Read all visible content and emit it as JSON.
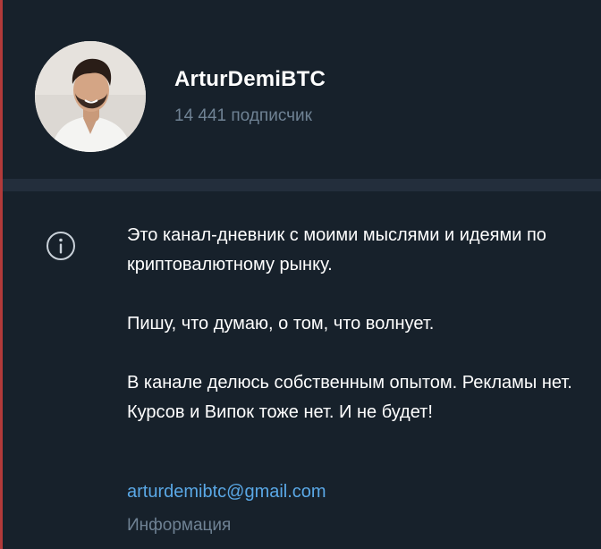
{
  "channel": {
    "name": "ArturDemiBTC",
    "subscribers": "14 441 подписчик"
  },
  "info": {
    "paragraphs": [
      "Это канал-дневник с моими мыслями и идеями по криптовалютному рынку.",
      "Пишу, что думаю, о том, что волнует.",
      "В канале делюсь собственным опытом. Рекламы нет. Курсов и Випок тоже нет. И не будет!"
    ],
    "email": "arturdemibtc@gmail.com",
    "label": "Информация"
  },
  "colors": {
    "background": "#17212b",
    "divider": "#232e3c",
    "link": "#5aa8e6",
    "muted": "#6f8294"
  },
  "icons": {
    "info": "info-circle-icon"
  }
}
